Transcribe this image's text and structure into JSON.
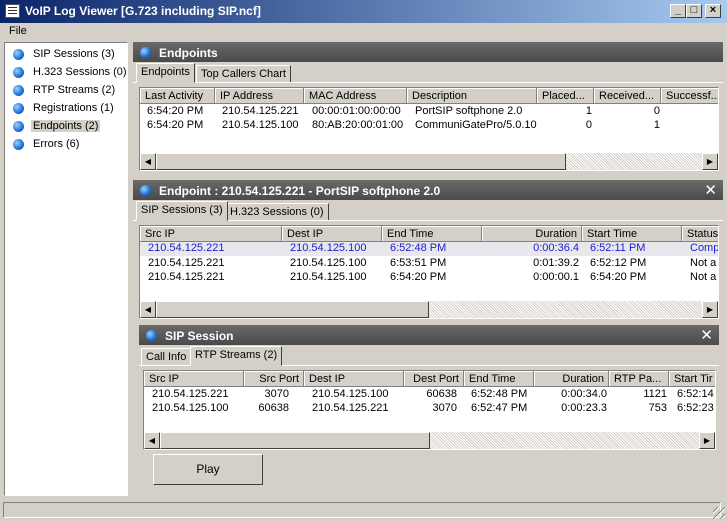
{
  "window": {
    "title": "VoIP Log Viewer [G.723 including SIP.ncf]"
  },
  "menu": {
    "file": "File"
  },
  "sidebar": {
    "items": [
      {
        "label": "SIP Sessions (3)"
      },
      {
        "label": "H.323 Sessions (0)"
      },
      {
        "label": "RTP Streams (2)"
      },
      {
        "label": "Registrations (1)"
      },
      {
        "label": "Endpoints (2)",
        "selected": true
      },
      {
        "label": "Errors (6)"
      }
    ]
  },
  "endpoints_panel": {
    "title": "Endpoints",
    "tabs": [
      "Endpoints",
      "Top Callers Chart"
    ],
    "columns": [
      "Last Activity",
      "IP Address",
      "MAC Address",
      "Description",
      "Placed...",
      "Received...",
      "Successf..."
    ],
    "rows": [
      [
        "6:54:20 PM",
        "210.54.125.221",
        "00:00:01:00:00:00",
        "PortSIP softphone 2.0",
        "1",
        "0",
        ""
      ],
      [
        "6:54:20 PM",
        "210.54.125.100",
        "80:AB:20:00:01:00",
        "CommuniGatePro/5.0.10",
        "0",
        "1",
        ""
      ]
    ]
  },
  "endpoint_detail": {
    "title": "Endpoint : 210.54.125.221 - PortSIP softphone 2.0",
    "close": "✕",
    "tabs": [
      "SIP Sessions (3)",
      "H.323 Sessions (0)"
    ],
    "columns": [
      "Src IP",
      "Dest IP",
      "End Time",
      "Duration",
      "Start Time",
      "Status"
    ],
    "rows": [
      [
        "210.54.125.221",
        "210.54.125.100",
        "6:52:48 PM",
        "0:00:36.4",
        "6:52:11 PM",
        "Comp"
      ],
      [
        "210.54.125.221",
        "210.54.125.100",
        "6:53:51 PM",
        "0:01:39.2",
        "6:52:12 PM",
        "Not a"
      ],
      [
        "210.54.125.221",
        "210.54.125.100",
        "6:54:20 PM",
        "0:00:00.1",
        "6:54:20 PM",
        "Not a"
      ]
    ]
  },
  "sip_session": {
    "title": "SIP Session",
    "close": "✕",
    "tabs": [
      "Call Info",
      "RTP Streams (2)"
    ],
    "columns": [
      "Src IP",
      "Src Port",
      "Dest IP",
      "Dest Port",
      "End Time",
      "Duration",
      "RTP Pa...",
      "Start Tir"
    ],
    "rows": [
      [
        "210.54.125.221",
        "3070",
        "210.54.125.100",
        "60638",
        "6:52:48 PM",
        "0:00:34.0",
        "1121",
        "6:52:14"
      ],
      [
        "210.54.125.100",
        "60638",
        "210.54.125.221",
        "3070",
        "6:52:47 PM",
        "0:00:23.3",
        "753",
        "6:52:23"
      ]
    ],
    "play_label": "Play"
  },
  "colors": {
    "titlebar_start": "#0a246a",
    "titlebar_end": "#a6caf0",
    "panel_header": "#4a4a4a",
    "highlight_text": "#1c1cd0"
  }
}
